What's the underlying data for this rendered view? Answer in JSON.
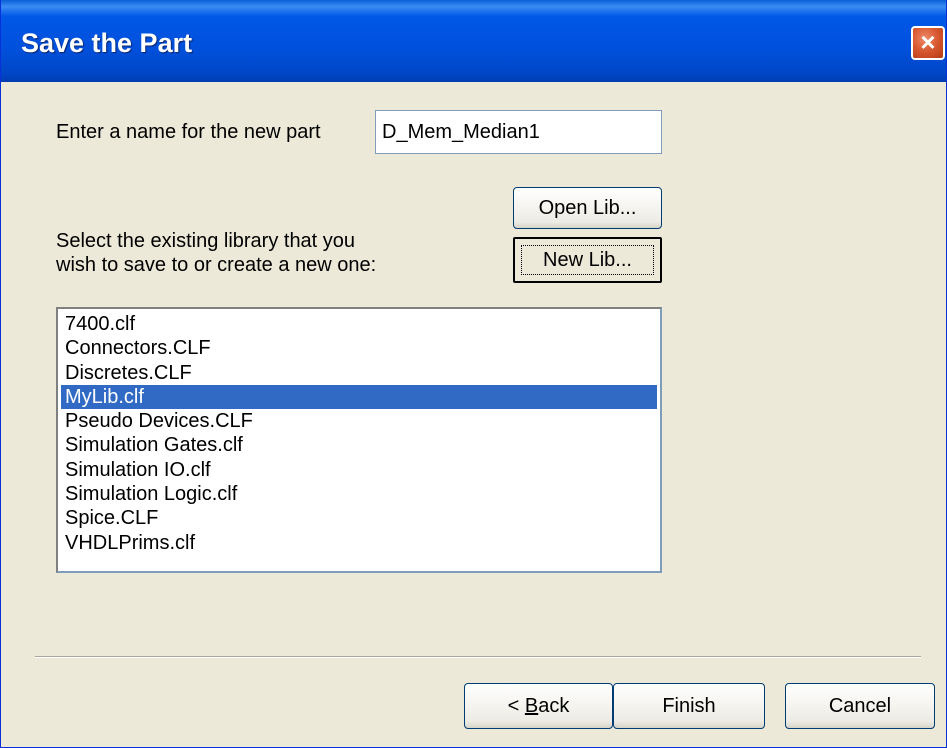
{
  "window": {
    "title": "Save the Part",
    "close_label": "×"
  },
  "part_name": {
    "label": "Enter a name for the new part",
    "value": "D_Mem_Median1"
  },
  "library": {
    "prompt_line1": "Select the existing library that you",
    "prompt_line2": "wish to save to or create a new one:",
    "open_lib_label": "Open Lib...",
    "new_lib_label": "New Lib...",
    "items": [
      "7400.clf",
      "Connectors.CLF",
      "Discretes.CLF",
      "MyLib.clf",
      "Pseudo Devices.CLF",
      "Simulation Gates.clf",
      "Simulation IO.clf",
      "Simulation Logic.clf",
      "Spice.CLF",
      "VHDLPrims.clf"
    ],
    "selected_item": "MyLib.clf"
  },
  "footer": {
    "back_prefix": "< ",
    "back_mnemonic": "B",
    "back_rest": "ack",
    "finish_label": "Finish",
    "cancel_label": "Cancel"
  },
  "colors": {
    "dialog_background": "#ece9d8",
    "titlebar": "#0054e3",
    "selection": "#316ac5"
  }
}
